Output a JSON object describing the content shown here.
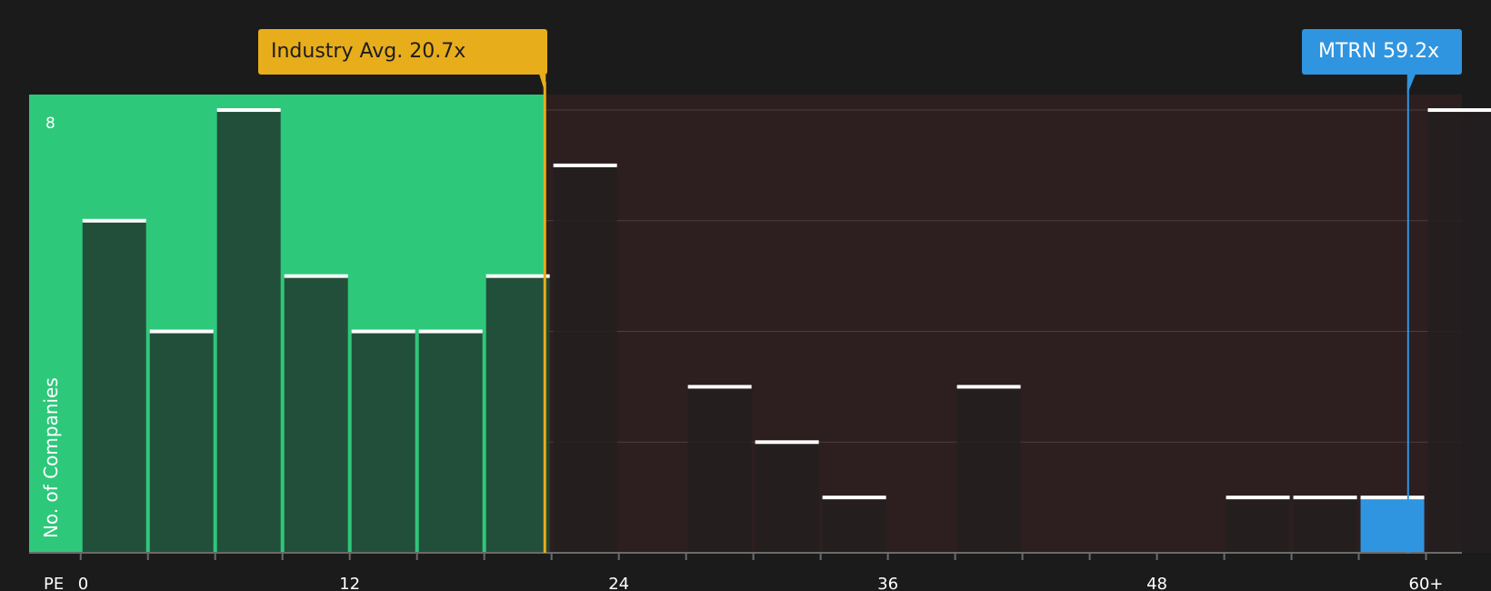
{
  "colors": {
    "background": "#1b1b1c",
    "below_avg_zone": "#2ec87b",
    "above_avg_zone": "#2d1e20",
    "bar_dark": "#224936",
    "bar_neutral": "#231f20",
    "bar_top": "#ffffff",
    "industry_avg": "#e8ad1b",
    "company": "#2f95e0"
  },
  "chart_data": {
    "type": "bar",
    "xlabel": "PE",
    "ylabel": "No. of Companies",
    "xlim": [
      -2.3,
      61.6
    ],
    "ylim": [
      0,
      8.28
    ],
    "x_ticks": [
      {
        "value": 0,
        "label": "0"
      },
      {
        "value": 12,
        "label": "12"
      },
      {
        "value": 24,
        "label": "24"
      },
      {
        "value": 36,
        "label": "36"
      },
      {
        "value": 48,
        "label": "48"
      },
      {
        "value": 60,
        "label": "60+"
      }
    ],
    "y_ticks": [
      {
        "value": 8,
        "label": "8"
      }
    ],
    "y_gridlines": [
      2,
      4,
      6,
      8
    ],
    "bins": [
      {
        "start": 0,
        "end": 3,
        "count": 6
      },
      {
        "start": 3,
        "end": 6,
        "count": 4
      },
      {
        "start": 6,
        "end": 9,
        "count": 8
      },
      {
        "start": 9,
        "end": 12,
        "count": 5
      },
      {
        "start": 12,
        "end": 15,
        "count": 4
      },
      {
        "start": 15,
        "end": 18,
        "count": 4
      },
      {
        "start": 18,
        "end": 21,
        "count": 5
      },
      {
        "start": 21,
        "end": 24,
        "count": 7
      },
      {
        "start": 24,
        "end": 27,
        "count": 0
      },
      {
        "start": 27,
        "end": 30,
        "count": 3
      },
      {
        "start": 30,
        "end": 33,
        "count": 2
      },
      {
        "start": 33,
        "end": 36,
        "count": 1
      },
      {
        "start": 36,
        "end": 39,
        "count": 0
      },
      {
        "start": 39,
        "end": 42,
        "count": 3
      },
      {
        "start": 42,
        "end": 45,
        "count": 0
      },
      {
        "start": 45,
        "end": 48,
        "count": 0
      },
      {
        "start": 48,
        "end": 51,
        "count": 0
      },
      {
        "start": 51,
        "end": 54,
        "count": 1
      },
      {
        "start": 54,
        "end": 57,
        "count": 1
      },
      {
        "start": 57,
        "end": 60,
        "count": 1,
        "highlight": true
      },
      {
        "start": 60,
        "end": 63,
        "count": 8
      }
    ],
    "industry_avg": {
      "value": 20.7,
      "label": "Industry Avg. 20.7x"
    },
    "company": {
      "ticker": "MTRN",
      "value": 59.2,
      "label": "MTRN 59.2x"
    }
  }
}
